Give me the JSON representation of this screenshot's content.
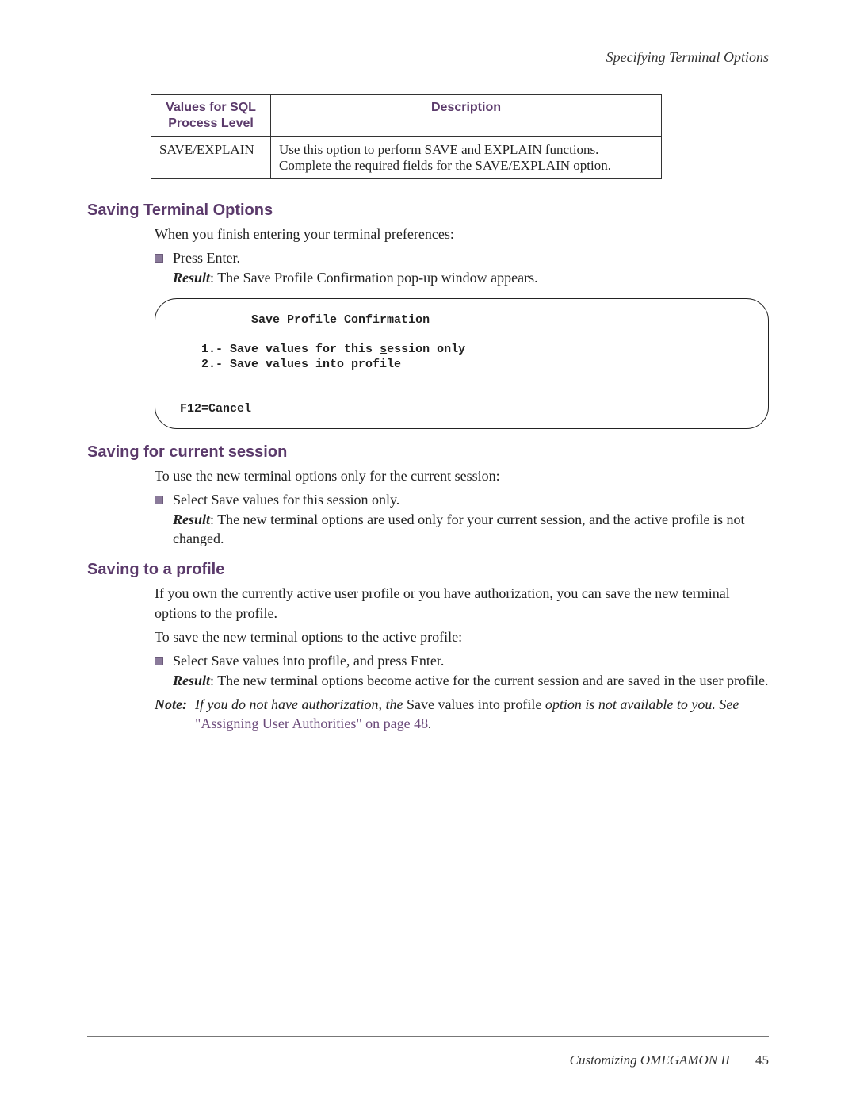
{
  "running_head": "Specifying Terminal Options",
  "table": {
    "headers": [
      "Values for SQL Process Level",
      "Description"
    ],
    "rows": [
      {
        "value": "SAVE/EXPLAIN",
        "description": "Use this option to perform SAVE and EXPLAIN functions. Complete the required fields for the SAVE/EXPLAIN option."
      }
    ]
  },
  "section1": {
    "heading": "Saving Terminal Options",
    "intro": "When you finish entering your terminal preferences:",
    "bullet_action": "Press Enter.",
    "result_label": "Result",
    "result_text": ": The Save Profile Confirmation pop-up window appears."
  },
  "terminal": {
    "title": "Save Profile Confirmation",
    "line1_num": "1.- Save values for this ",
    "line1_under": "s",
    "line1_rest": "ession only",
    "line2": "2.- Save values into profile",
    "footer": "F12=Cancel"
  },
  "section2": {
    "heading": "Saving for current session",
    "intro": "To use the new terminal options only for the current session:",
    "bullet_action": "Select Save values for this session only.",
    "result_label": "Result",
    "result_text": ": The new terminal options are used only for your current session, and the active profile is not changed."
  },
  "section3": {
    "heading": "Saving to a profile",
    "intro1": "If you own the currently active user profile or you have authorization, you can save the new terminal options to the profile.",
    "intro2": "To save the new terminal options to the active profile:",
    "bullet_action": "Select Save values into profile, and press Enter.",
    "result_label": "Result",
    "result_text": ": The new terminal options become active for the current session and are saved in the user profile.",
    "note_label": "Note:",
    "note_pre": "If you do not have authorization, the ",
    "note_upright": "Save values into profile",
    "note_mid": " option is not available to you. See ",
    "note_link": "\"Assigning User Authorities\" on page 48",
    "note_post": "."
  },
  "footer": {
    "text": "Customizing OMEGAMON II",
    "page": "45"
  }
}
